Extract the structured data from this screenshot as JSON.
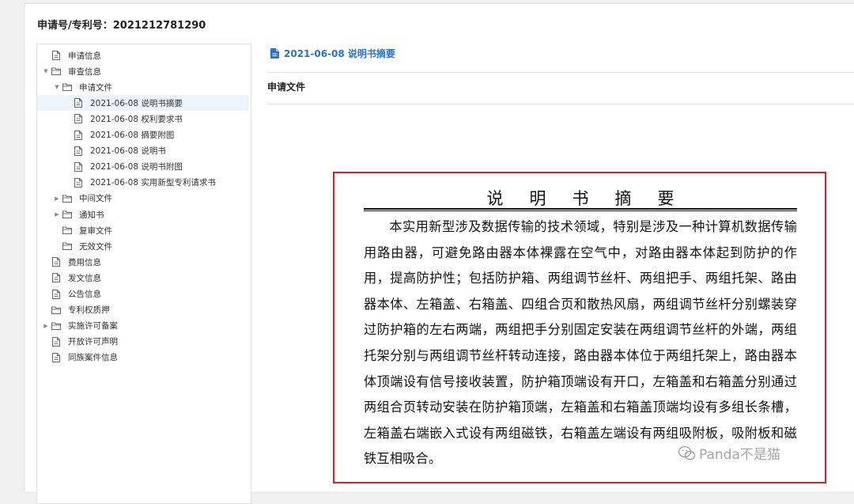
{
  "header": {
    "title": "申请号/专利号：2021212781290"
  },
  "tree": {
    "items": [
      {
        "label": "申请信息",
        "level": 0,
        "arrow": "",
        "icon": "file-icon"
      },
      {
        "label": "审查信息",
        "level": 0,
        "arrow": "expanded",
        "icon": "folder-icon"
      },
      {
        "label": "申请文件",
        "level": 1,
        "arrow": "expanded",
        "icon": "folder-icon"
      },
      {
        "label": "2021-06-08 说明书摘要",
        "level": 2,
        "arrow": "",
        "icon": "file-icon",
        "selected": true
      },
      {
        "label": "2021-06-08 权利要求书",
        "level": 2,
        "arrow": "",
        "icon": "file-icon"
      },
      {
        "label": "2021-06-08 摘要附图",
        "level": 2,
        "arrow": "",
        "icon": "file-icon"
      },
      {
        "label": "2021-06-08 说明书",
        "level": 2,
        "arrow": "",
        "icon": "file-icon"
      },
      {
        "label": "2021-06-08 说明书附图",
        "level": 2,
        "arrow": "",
        "icon": "file-icon"
      },
      {
        "label": "2021-06-08 实用新型专利请求书",
        "level": 2,
        "arrow": "",
        "icon": "file-icon"
      },
      {
        "label": "中间文件",
        "level": 1,
        "arrow": "collapsed",
        "icon": "folder-icon"
      },
      {
        "label": "通知书",
        "level": 1,
        "arrow": "collapsed",
        "icon": "folder-icon"
      },
      {
        "label": "复审文件",
        "level": 1,
        "arrow": "",
        "icon": "folder-icon"
      },
      {
        "label": "无效文件",
        "level": 1,
        "arrow": "",
        "icon": "folder-icon"
      },
      {
        "label": "费用信息",
        "level": 0,
        "arrow": "",
        "icon": "file-icon"
      },
      {
        "label": "发文信息",
        "level": 0,
        "arrow": "",
        "icon": "file-icon"
      },
      {
        "label": "公告信息",
        "level": 0,
        "arrow": "",
        "icon": "file-icon"
      },
      {
        "label": "专利权质押",
        "level": 0,
        "arrow": "",
        "icon": "folder-icon"
      },
      {
        "label": "实施许可备案",
        "level": 0,
        "arrow": "collapsed",
        "icon": "folder-icon"
      },
      {
        "label": "开放许可声明",
        "level": 0,
        "arrow": "",
        "icon": "file-icon"
      },
      {
        "label": "同族案件信息",
        "level": 0,
        "arrow": "",
        "icon": "file-icon"
      }
    ]
  },
  "content": {
    "doc_link": "2021-06-08 说明书摘要",
    "section_title": "申请文件",
    "document": {
      "heading": "说明书摘要",
      "body": "本实用新型涉及数据传输的技术领域，特别是涉及一种计算机数据传输用路由器，可避免路由器本体裸露在空气中，对路由器本体起到防护的作用，提高防护性；包括防护箱、两组调节丝杆、两组把手、两组托架、路由器本体、左箱盖、右箱盖、四组合页和散热风扇，两组调节丝杆分别螺装穿过防护箱的左右两端，两组把手分别固定安装在两组调节丝杆的外端，两组托架分别与两组调节丝杆转动连接，路由器本体位于两组托架上，路由器本体顶端设有信号接收装置，防护箱顶端设有开口，左箱盖和右箱盖分别通过两组合页转动安装在防护箱顶端，左箱盖和右箱盖顶端均设有多组长条槽，左箱盖右端嵌入式设有两组磁铁，右箱盖左端设有两组吸附板，吸附板和磁铁互相吸合。"
    }
  },
  "watermark": {
    "text": "Panda不是猫",
    "icon": "wechat-icon"
  },
  "colors": {
    "link": "#2f6fc9",
    "highlight_border": "#e02020",
    "selected_bg": "#eef4fb"
  }
}
